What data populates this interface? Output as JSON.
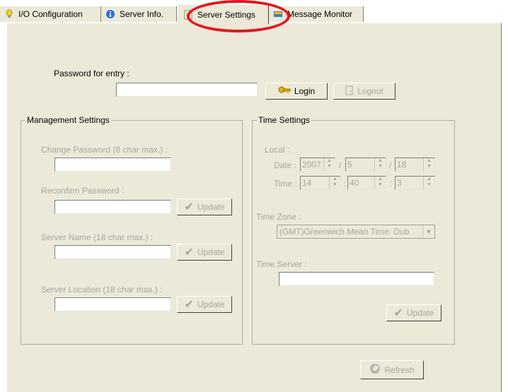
{
  "tabs": [
    {
      "label": "I/O Configuration",
      "icon": "lightbulb-icon"
    },
    {
      "label": "Server Info.",
      "icon": "info-icon"
    },
    {
      "label": "Server Settings",
      "icon": "settings-page-icon"
    },
    {
      "label": "Message Monitor",
      "icon": "message-monitor-icon"
    }
  ],
  "active_tab": "Server Settings",
  "entry": {
    "label": "Password for entry :",
    "value": "",
    "login": "Login",
    "logout": "Logout"
  },
  "management": {
    "title": "Management Settings",
    "change_password_label": "Change Password (8 char max.) :",
    "reconfirm_label": "Reconfirm Password :",
    "server_name_label": "Server Name (18 char max.) :",
    "server_location_label": "Server Location (18 char max.) :",
    "update": "Update"
  },
  "time": {
    "title": "Time Settings",
    "local_label": "Local :",
    "date_label": "Date :",
    "time_label": "Time :",
    "date": {
      "year": "2007",
      "month": "5",
      "day": "18",
      "sep": "/"
    },
    "clock": {
      "hour": "14",
      "minute": "40",
      "second": "3",
      "sep": ":"
    },
    "timezone_label": "Time Zone :",
    "timezone_value": "(GMT)Greenwich Mean Time: Dub",
    "time_server_label": "Time Server :",
    "time_server_value": "",
    "update": "Update"
  },
  "refresh": "Refresh",
  "colors": {
    "highlight": "#e8141a",
    "panel": "#ece9d8",
    "disabled_text": "#a7a6a0"
  }
}
